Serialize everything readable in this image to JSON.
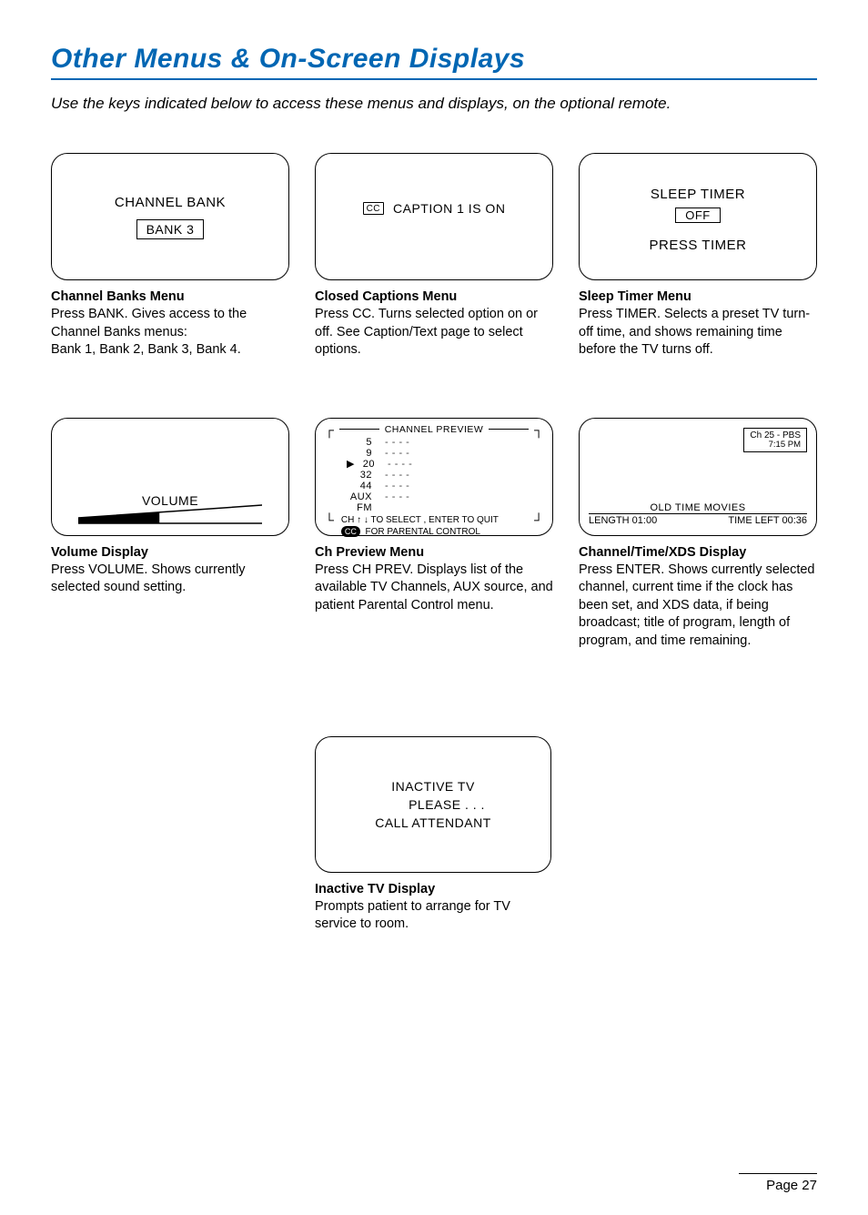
{
  "page": {
    "title": "Other Menus & On-Screen Displays",
    "intro": "Use the keys indicated below to access these menus and displays, on the optional remote.",
    "number": "Page 27"
  },
  "channel_bank": {
    "panel_title": "CHANNEL BANK",
    "panel_value": "BANK 3",
    "title": "Channel Banks Menu",
    "body": "Press BANK. Gives access to the Channel Banks menus:\nBank 1, Bank 2, Bank 3, Bank 4."
  },
  "captions": {
    "cc_label": "CC",
    "panel_text": "CAPTION 1 IS ON",
    "title": "Closed Captions Menu",
    "body": "Press CC. Turns selected option on or off. See Caption/Text page to select options."
  },
  "sleep": {
    "line1": "SLEEP TIMER",
    "off": "OFF",
    "line2": "PRESS TIMER",
    "title": "Sleep Timer Menu",
    "body": "Press TIMER. Selects a preset TV turn-off time, and shows remaining time before the TV turns off."
  },
  "volume": {
    "panel_label": "VOLUME",
    "title": "Volume Display",
    "body": "Press VOLUME. Shows currently selected sound setting."
  },
  "preview": {
    "header": "CHANNEL PREVIEW",
    "rows": [
      {
        "num": "5",
        "dots": "- - - -"
      },
      {
        "num": "9",
        "dots": "- - - -"
      },
      {
        "num": "20",
        "dots": "- - - -"
      },
      {
        "num": "32",
        "dots": "- - - -"
      },
      {
        "num": "44",
        "dots": "- - - -"
      },
      {
        "num": "AUX",
        "dots": "- - - -"
      },
      {
        "num": "FM",
        "dots": ""
      }
    ],
    "footer1": "CH ↑ ↓ TO SELECT , ENTER TO QUIT",
    "footer_cc": "CC",
    "footer2": "FOR PARENTAL CONTROL",
    "pointer": "▶",
    "title": "Ch Preview Menu",
    "body": "Press CH PREV. Displays list of the available TV Channels, AUX source, and patient Parental Control menu."
  },
  "xds": {
    "box_line1": "Ch 25 - PBS",
    "box_line2": "7:15 PM",
    "program": "OLD TIME MOVIES",
    "length": "LENGTH 01:00",
    "timeleft": "TIME LEFT 00:36",
    "title": "Channel/Time/XDS Display",
    "body": "Press ENTER. Shows currently selected channel, current time if the clock has been set, and XDS data, if being broadcast; title of program, length of program, and time remaining."
  },
  "inactive": {
    "line1": "INACTIVE TV",
    "line2": "PLEASE . . .",
    "line3": "CALL ATTENDANT",
    "title": "Inactive TV Display",
    "body": "Prompts patient to arrange for TV service to room."
  }
}
